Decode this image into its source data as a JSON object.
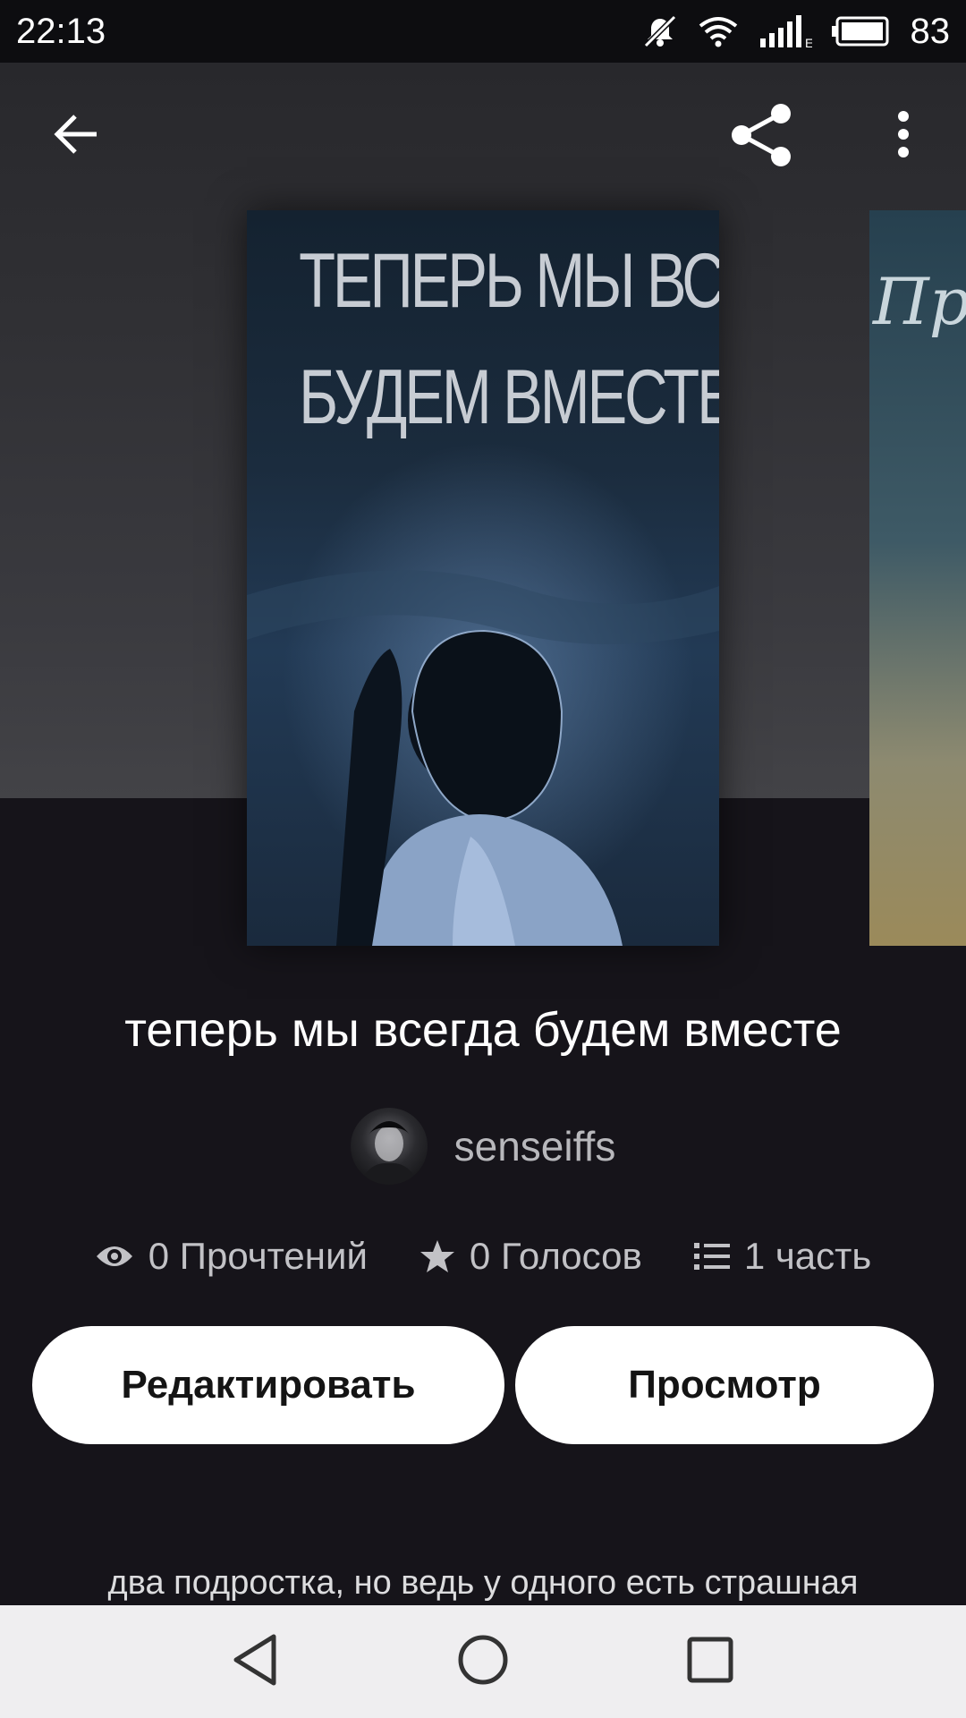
{
  "status_bar": {
    "time": "22:13",
    "battery_percent": "83",
    "network_label": "E"
  },
  "top_bar": {
    "icons": [
      "back-arrow-icon",
      "share-icon",
      "more-vert-icon"
    ]
  },
  "cover": {
    "title_line1": "ТЕПЕРЬ МЫ ВСЕГДА",
    "title_line2": "БУДЕМ ВМЕСТЕ",
    "next_cover_partial_text": "Пр"
  },
  "story": {
    "title": "теперь мы всегда будем вместе",
    "author": "senseiffs",
    "stats": {
      "reads": "0 Прочтений",
      "votes": "0 Голосов",
      "parts": "1 часть"
    },
    "description_first_line": "два подростка, но ведь у одного есть страшная"
  },
  "actions": {
    "edit_label": "Редактировать",
    "preview_label": "Просмотр"
  },
  "colors": {
    "background": "#16141a",
    "button_bg": "#ffffff",
    "nav_bar_bg": "#efeef0"
  }
}
